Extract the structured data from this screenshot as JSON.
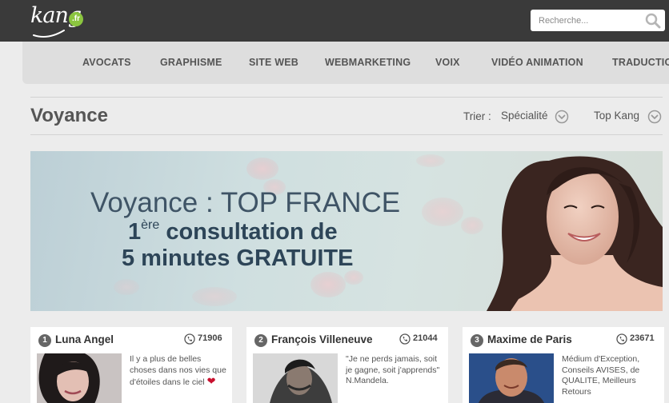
{
  "header": {
    "logo_text": "kang",
    "logo_badge": ".fr",
    "search_placeholder": "Recherche..."
  },
  "nav": {
    "items": [
      "AVOCATS",
      "GRAPHISME",
      "SITE WEB",
      "WEBMARKETING",
      "VOIX",
      "VIDÉO ANIMATION",
      "TRADUCTION"
    ]
  },
  "page": {
    "title": "Voyance",
    "sort_label": "Trier :",
    "sort_options": [
      "Spécialité",
      "Top Kang"
    ]
  },
  "banner": {
    "line1": "Voyance : TOP FRANCE",
    "line2_prefix": "1",
    "line2_sup": "ère",
    "line2_rest": " consultation de",
    "line3": "5 minutes GRATUITE"
  },
  "cards": [
    {
      "rank": "1",
      "name": "Luna Angel",
      "count": "71906",
      "desc": "Il y a plus de belles choses dans nos vies que d'étoiles dans le ciel"
    },
    {
      "rank": "2",
      "name": "François Villeneuve",
      "count": "21044",
      "desc": "\"Je ne perds jamais, soit je gagne, soit j'apprends\" N.Mandela."
    },
    {
      "rank": "3",
      "name": "Maxime de Paris",
      "count": "23671",
      "desc": "Médium d'Exception, Conseils AVISES, de QUALITE, Meilleurs Retours"
    }
  ],
  "colors": {
    "topbar": "#3a3a3a",
    "nav_bg": "#dedede",
    "logo_badge": "#8bc53f",
    "heading_text": "#2d4558"
  },
  "icons": {
    "search": "magnifier-icon",
    "sort": "chevron-down-circle-icon",
    "phone": "phone-circle-icon",
    "heart": "heart-icon"
  }
}
